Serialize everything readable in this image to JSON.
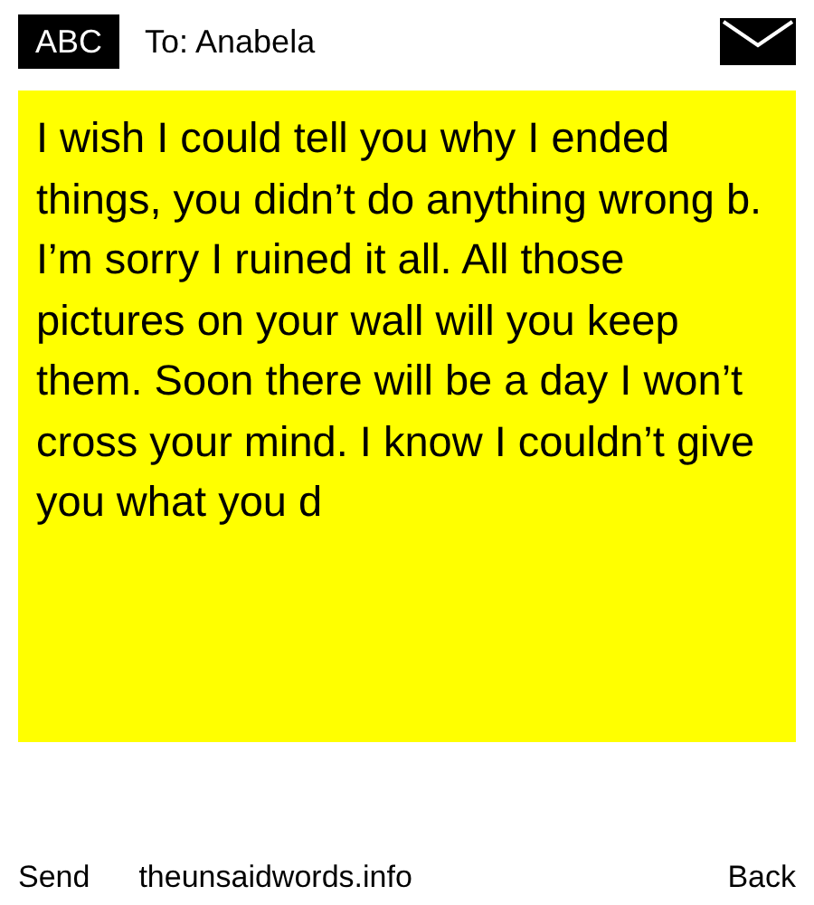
{
  "header": {
    "input_mode": "ABC",
    "recipient": "To: Anabela"
  },
  "message": {
    "text": "I wish I could tell you why I ended things, you didn’t do anything wrong b. I’m sorry I ruined it all. All those pictures on your wall will you keep them. Soon there will be a day I won’t cross your mind. I know I couldn’t give you what you d"
  },
  "softkeys": {
    "left": "Send",
    "center": "theunsaidwords.info",
    "right": "Back"
  }
}
